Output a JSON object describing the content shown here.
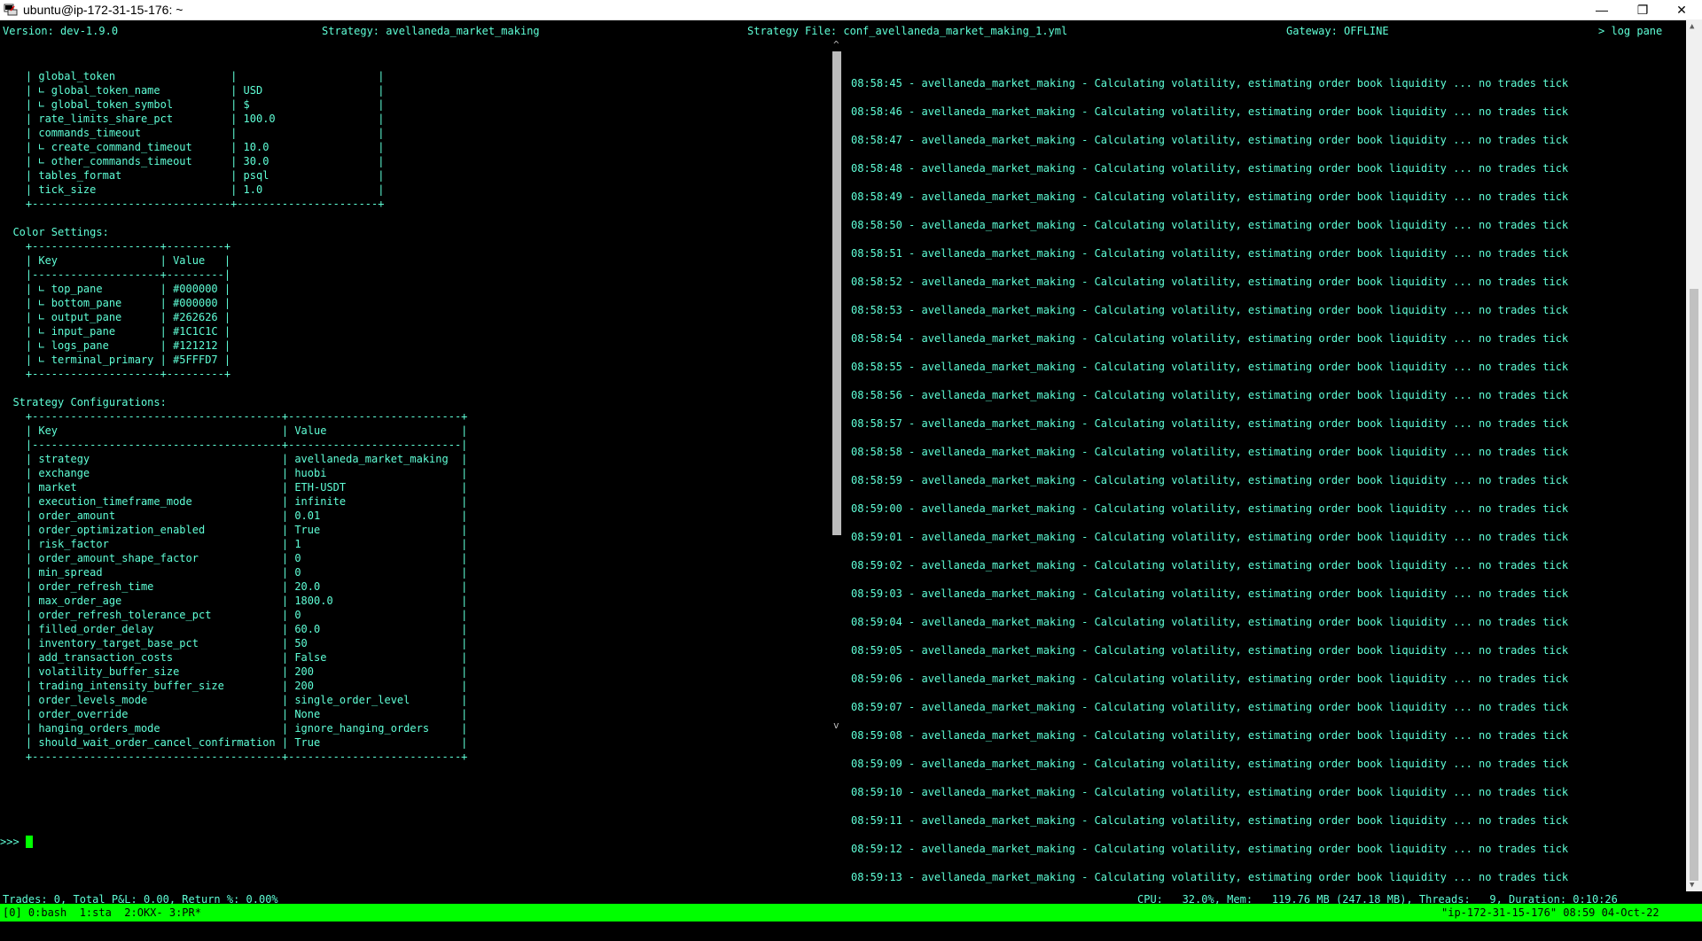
{
  "window": {
    "title": "ubuntu@ip-172-31-15-176: ~",
    "minimize_glyph": "—",
    "restore_glyph": "❐",
    "close_glyph": "✕"
  },
  "header": {
    "version": "Version: dev-1.9.0",
    "strategy": "Strategy: avellaneda_market_making",
    "strategy_file": "Strategy File: conf_avellaneda_market_making_1.yml",
    "gateway": "Gateway: OFFLINE",
    "log_pane": "> log pane"
  },
  "left_lines": [
    "    | global_token                  |                      |",
    "    | ∟ global_token_name           | USD                  |",
    "    | ∟ global_token_symbol         | $                    |",
    "    | rate_limits_share_pct         | 100.0                |",
    "    | commands_timeout              |                      |",
    "    | ∟ create_command_timeout      | 10.0                 |",
    "    | ∟ other_commands_timeout      | 30.0                 |",
    "    | tables_format                 | psql                 |",
    "    | tick_size                     | 1.0                  |",
    "    +-------------------------------+----------------------+",
    "",
    "  Color Settings:",
    "    +--------------------+---------+",
    "    | Key                | Value   |",
    "    |--------------------+---------|",
    "    | ∟ top_pane         | #000000 |",
    "    | ∟ bottom_pane      | #000000 |",
    "    | ∟ output_pane      | #262626 |",
    "    | ∟ input_pane       | #1C1C1C |",
    "    | ∟ logs_pane        | #121212 |",
    "    | ∟ terminal_primary | #5FFFD7 |",
    "    +--------------------+---------+",
    "",
    "  Strategy Configurations:",
    "    +---------------------------------------+---------------------------+",
    "    | Key                                   | Value                     |",
    "    |---------------------------------------+---------------------------|",
    "    | strategy                              | avellaneda_market_making  |",
    "    | exchange                              | huobi                     |",
    "    | market                                | ETH-USDT                  |",
    "    | execution_timeframe_mode              | infinite                  |",
    "    | order_amount                          | 0.01                      |",
    "    | order_optimization_enabled            | True                      |",
    "    | risk_factor                           | 1                         |",
    "    | order_amount_shape_factor             | 0                         |",
    "    | min_spread                            | 0                         |",
    "    | order_refresh_time                    | 20.0                      |",
    "    | max_order_age                         | 1800.0                    |",
    "    | order_refresh_tolerance_pct           | 0                         |",
    "    | filled_order_delay                    | 60.0                      |",
    "    | inventory_target_base_pct             | 50                        |",
    "    | add_transaction_costs                 | False                     |",
    "    | volatility_buffer_size                | 200                       |",
    "    | trading_intensity_buffer_size         | 200                       |",
    "    | order_levels_mode                     | single_order_level        |",
    "    | order_override                        | None                      |",
    "    | hanging_orders_mode                   | ignore_hanging_orders     |",
    "    | should_wait_order_cancel_confirmation | True                      |",
    "    +---------------------------------------+---------------------------+"
  ],
  "prompt": ">>> ",
  "logs": {
    "message": " - avellaneda_market_making - Calculating volatility, estimating order book liquidity ... no trades tick",
    "times": [
      "08:58:45",
      "08:58:46",
      "08:58:47",
      "08:58:48",
      "08:58:49",
      "08:58:50",
      "08:58:51",
      "08:58:52",
      "08:58:53",
      "08:58:54",
      "08:58:55",
      "08:58:56",
      "08:58:57",
      "08:58:58",
      "08:58:59",
      "08:59:00",
      "08:59:01",
      "08:59:02",
      "08:59:03",
      "08:59:04",
      "08:59:05",
      "08:59:06",
      "08:59:07",
      "08:59:08",
      "08:59:09",
      "08:59:10",
      "08:59:11",
      "08:59:12",
      "08:59:13"
    ]
  },
  "status": {
    "trades": "Trades: 0, Total P&L: 0.00, Return %: 0.00%",
    "system": "CPU:   32.0%, Mem:   119.76 MB (247.18 MB), Threads:   9, Duration: 0:10:26"
  },
  "tmux": {
    "windows": "[0] 0:bash  1:sta  2:OKX- 3:PR*",
    "host": "\"ip-172-31-15-176\" 08:59 04-Oct-22"
  },
  "scroll": {
    "up": "^",
    "down": "v"
  }
}
